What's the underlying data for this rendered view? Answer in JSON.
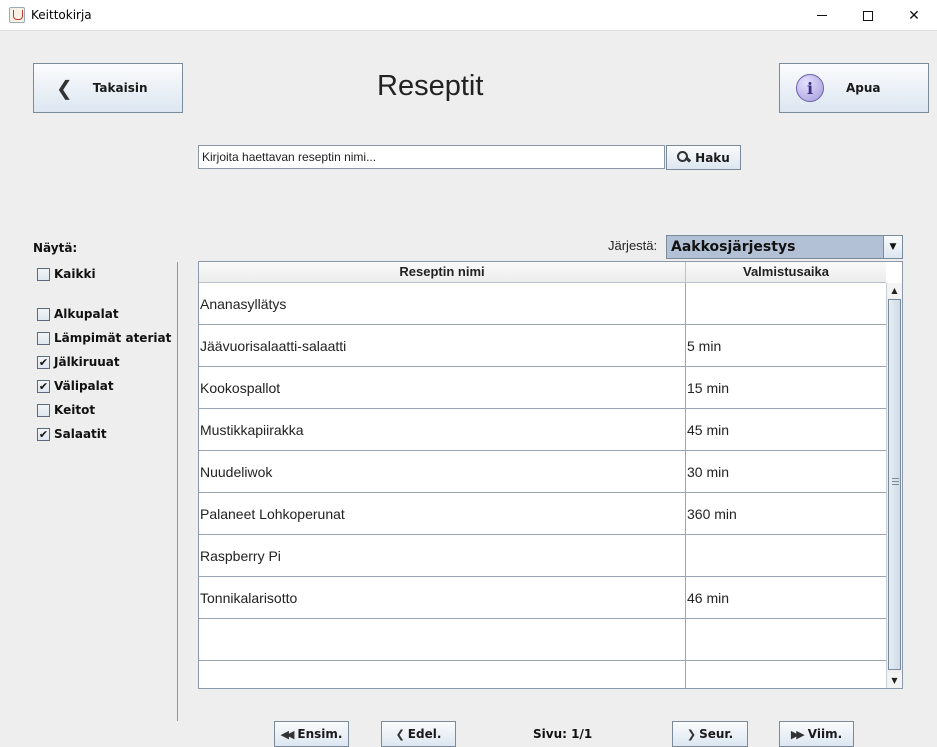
{
  "window": {
    "title": "Keittokirja",
    "minimize_glyph": "",
    "close_glyph": "✕"
  },
  "header": {
    "back_label": "Takaisin",
    "back_icon": "chevron-left-icon",
    "title": "Reseptit",
    "help_label": "Apua",
    "help_icon": "info-icon",
    "help_glyph": "i"
  },
  "search": {
    "value": "Kirjoita haettavan reseptin nimi...",
    "button_label": "Haku",
    "button_icon": "magnifier-icon"
  },
  "filter": {
    "label": "Näytä:",
    "items": [
      {
        "label": "Kaikki",
        "checked": false
      },
      {
        "label": "Alkupalat",
        "checked": false
      },
      {
        "label": "Lämpimät ateriat",
        "checked": false
      },
      {
        "label": "Jälkiruuat",
        "checked": true
      },
      {
        "label": "Välipalat",
        "checked": true
      },
      {
        "label": "Keitot",
        "checked": false
      },
      {
        "label": "Salaatit",
        "checked": true
      }
    ]
  },
  "sort": {
    "label": "Järjestä:",
    "selected": "Aakkosjärjestys"
  },
  "table": {
    "columns": [
      "Reseptin nimi",
      "Valmistusaika"
    ],
    "rows": [
      {
        "name": "Ananasyllätys",
        "time": ""
      },
      {
        "name": "Jäävuorisalaatti-salaatti",
        "time": "5 min"
      },
      {
        "name": "Kookospallot",
        "time": "15 min"
      },
      {
        "name": "Mustikkapiirakka",
        "time": "45 min"
      },
      {
        "name": "Nuudeliwok",
        "time": "30 min"
      },
      {
        "name": "Palaneet Lohkoperunat",
        "time": "360 min"
      },
      {
        "name": "Raspberry Pi",
        "time": ""
      },
      {
        "name": "Tonnikalarisotto",
        "time": "46 min"
      },
      {
        "name": "",
        "time": ""
      },
      {
        "name": "",
        "time": ""
      }
    ]
  },
  "pager": {
    "first_label": "Ensim.",
    "prev_label": "Edel.",
    "page_text": "Sivu: 1/1",
    "next_label": "Seur.",
    "last_label": "Viim."
  }
}
